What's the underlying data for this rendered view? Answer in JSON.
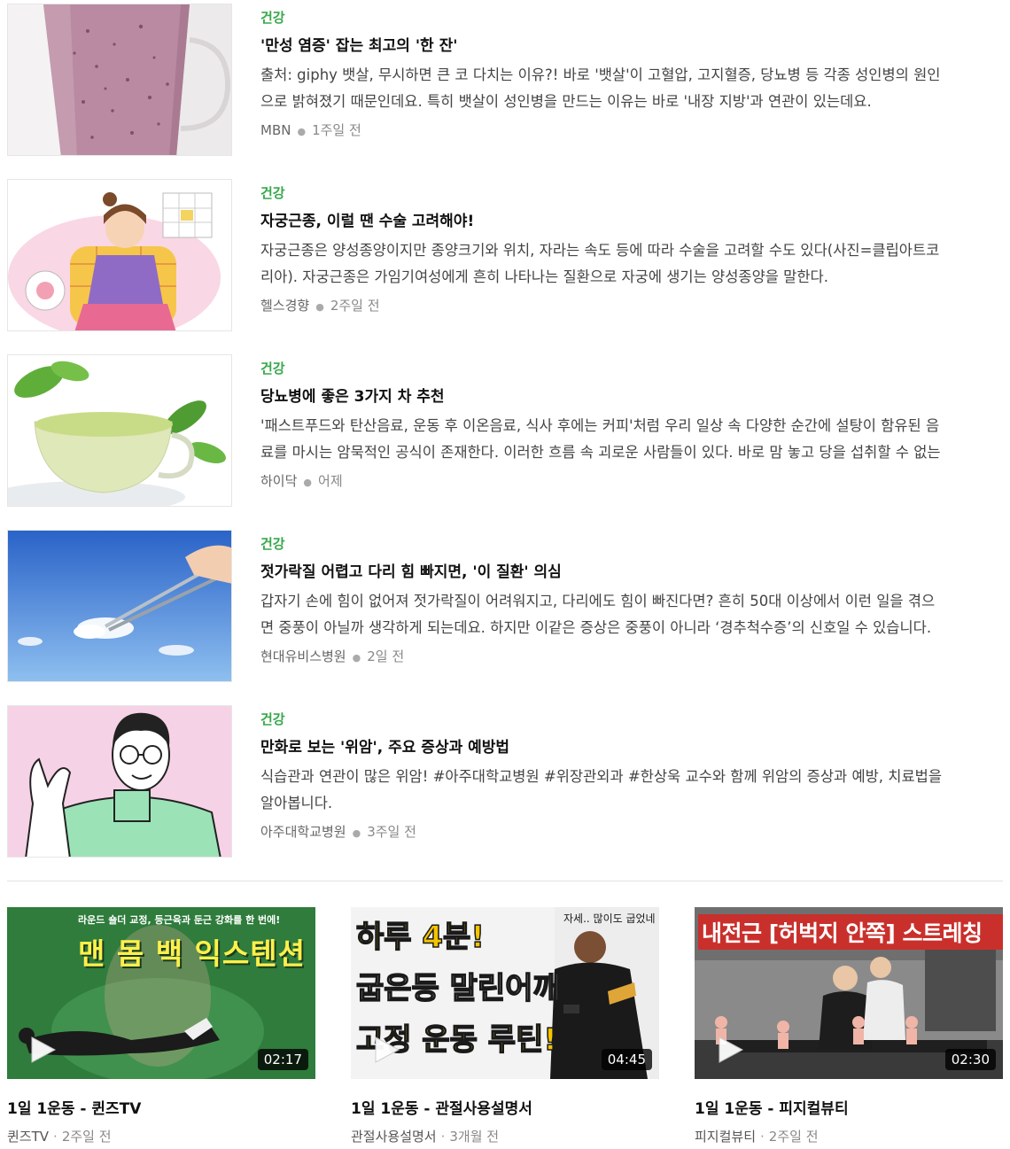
{
  "articles": [
    {
      "category": "건강",
      "title": "'만성 염증' 잡는 최고의 '한 잔'",
      "desc": "출처: giphy 뱃살, 무시하면 큰 코 다치는 이유?! 바로 '뱃살'이 고혈압, 고지혈증, 당뇨병 등 각종 성인병의 원인으로 밝혀졌기 때문인데요. 특히 뱃살이 성인병을 만드는 이유는 바로 '내장 지방'과 연관이 있는데요.",
      "source": "MBN",
      "time": "1주일 전"
    },
    {
      "category": "건강",
      "title": "자궁근종, 이럴 땐 수술 고려해야!",
      "desc": "자궁근종은 양성종양이지만 종양크기와 위치, 자라는 속도 등에 따라 수술을 고려할 수도 있다(사진=클립아트코리아). 자궁근종은 가임기여성에게 흔히 나타나는 질환으로 자궁에 생기는 양성종양을 말한다.",
      "source": "헬스경향",
      "time": "2주일 전"
    },
    {
      "category": "건강",
      "title": "당뇨병에 좋은 3가지 차 추천",
      "desc": "'패스트푸드와 탄산음료, 운동 후 이온음료, 식사 후에는 커피'처럼 우리 일상 속 다양한 순간에 설탕이 함유된 음료를 마시는 암묵적인 공식이 존재한다. 이러한 흐름 속 괴로운 사람들이 있다. 바로 맘 놓고 당을 섭취할 수 없는",
      "source": "하이닥",
      "time": "어제"
    },
    {
      "category": "건강",
      "title": "젓가락질 어렵고 다리 힘 빠지면, '이 질환' 의심",
      "desc": "갑자기 손에 힘이 없어져 젓가락질이 어려워지고, 다리에도 힘이 빠진다면? 흔히 50대 이상에서 이런 일을 겪으면 중풍이 아닐까 생각하게 되는데요. 하지만 이같은 증상은 중풍이 아니라 ‘경추척수증’의 신호일 수 있습니다.",
      "source": "현대유비스병원",
      "time": "2일 전"
    },
    {
      "category": "건강",
      "title": "만화로 보는 '위암', 주요 증상과 예방법",
      "desc": "식습관과 연관이 많은 위암! #아주대학교병원 #위장관외과 #한상욱 교수와 함께 위암의 증상과 예방, 치료법을 알아봅니다.",
      "source": "아주대학교병원",
      "time": "3주일 전"
    }
  ],
  "videos": [
    {
      "title": "1일 1운동 - 퀸즈TV",
      "channel": "퀸즈TV",
      "time": "2주일 전",
      "duration": "02:17",
      "overlay_small": "라운드 숄더 교정, 등근육과 둔근 강화를 한 번에!",
      "overlay_big": "맨 몸 백 익스텐션"
    },
    {
      "title": "1일 1운동 - 관절사용설명서",
      "channel": "관절사용설명서",
      "time": "3개월 전",
      "duration": "04:45",
      "overlay_lines": [
        "하루 4분!",
        "굽은등 말린어깨",
        "고정 운동 루틴!"
      ],
      "overlay_corner": "자세.. 많이도 굽었네"
    },
    {
      "title": "1일 1운동 - 피지컬뷰티",
      "channel": "피지컬뷰티",
      "time": "2주일 전",
      "duration": "02:30",
      "overlay_big": "내전근 [허벅지 안쪽] 스트레칭"
    }
  ],
  "colors": {
    "category": "#38a84c",
    "title": "#111111",
    "divider": "#e2e2e2"
  }
}
